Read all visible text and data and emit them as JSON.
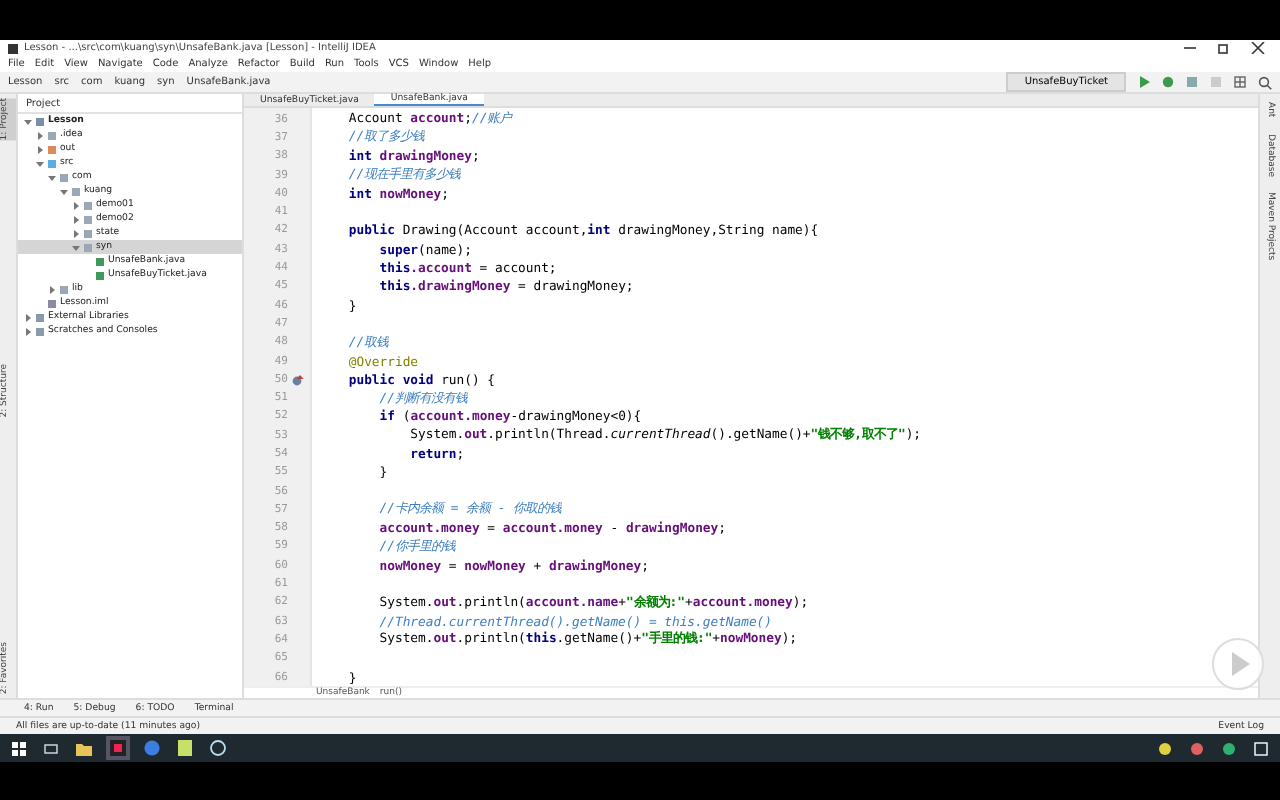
{
  "window": {
    "title": "Lesson - ...\\src\\com\\kuang\\syn\\UnsafeBank.java [Lesson] - IntelliJ IDEA"
  },
  "menu": [
    "File",
    "Edit",
    "View",
    "Navigate",
    "Code",
    "Analyze",
    "Refactor",
    "Build",
    "Run",
    "Tools",
    "VCS",
    "Window",
    "Help"
  ],
  "navbar": [
    "Lesson",
    "src",
    "com",
    "kuang",
    "syn",
    "UnsafeBank.java"
  ],
  "run_config": "UnsafeBuyTicket",
  "left_strip": [
    {
      "label": "1: Project",
      "selected": true
    },
    {
      "label": "2: Structure",
      "selected": false
    },
    {
      "label": "2: Favorites",
      "selected": false
    }
  ],
  "project": {
    "header": "Project",
    "tree": [
      {
        "label": "Lesson",
        "kind": "module",
        "expanded": true,
        "selected": false,
        "children": [
          {
            "label": ".idea",
            "kind": "folder",
            "expanded": false,
            "selected": false
          },
          {
            "label": "out",
            "kind": "excluded",
            "expanded": false,
            "selected": false
          },
          {
            "label": "src",
            "kind": "source",
            "expanded": true,
            "selected": false,
            "children": [
              {
                "label": "com",
                "kind": "folder",
                "expanded": true,
                "selected": false,
                "children": [
                  {
                    "label": "kuang",
                    "kind": "folder",
                    "expanded": true,
                    "selected": false,
                    "children": [
                      {
                        "label": "demo01",
                        "kind": "folder",
                        "expanded": false,
                        "selected": false
                      },
                      {
                        "label": "demo02",
                        "kind": "folder",
                        "expanded": false,
                        "selected": false
                      },
                      {
                        "label": "state",
                        "kind": "folder",
                        "expanded": false,
                        "selected": false
                      },
                      {
                        "label": "syn",
                        "kind": "folder",
                        "expanded": true,
                        "selected": true,
                        "children": [
                          {
                            "label": "UnsafeBank.java",
                            "kind": "java",
                            "selected": false
                          },
                          {
                            "label": "UnsafeBuyTicket.java",
                            "kind": "java",
                            "selected": false
                          }
                        ]
                      }
                    ]
                  }
                ]
              },
              {
                "label": "lib",
                "kind": "folder",
                "expanded": false,
                "selected": false
              }
            ]
          },
          {
            "label": "Lesson.iml",
            "kind": "file",
            "selected": false
          }
        ]
      },
      {
        "label": "External Libraries",
        "kind": "library",
        "expanded": false,
        "selected": false
      },
      {
        "label": "Scratches and Consoles",
        "kind": "library",
        "expanded": false,
        "selected": false
      }
    ]
  },
  "editor": {
    "tabs": [
      {
        "label": "UnsafeBuyTicket.java",
        "selected": false
      },
      {
        "label": "UnsafeBank.java",
        "selected": true
      }
    ],
    "lines": [
      {
        "number": "36",
        "gutter_marker": false,
        "tokens": [
          {
            "text": "    Account ",
            "kind": "plain"
          },
          {
            "text": "account",
            "kind": "field"
          },
          {
            "text": ";",
            "kind": "plain"
          },
          {
            "text": "//账户",
            "kind": "comment"
          }
        ]
      },
      {
        "number": "37",
        "gutter_marker": false,
        "tokens": [
          {
            "text": "    //取了多少钱",
            "kind": "comment"
          }
        ]
      },
      {
        "number": "38",
        "gutter_marker": false,
        "tokens": [
          {
            "text": "    int",
            "kind": "keyword"
          },
          {
            "text": " drawingMoney",
            "kind": "field"
          },
          {
            "text": ";",
            "kind": "plain"
          }
        ]
      },
      {
        "number": "39",
        "gutter_marker": false,
        "tokens": [
          {
            "text": "    //现在手里有多少钱",
            "kind": "comment"
          }
        ]
      },
      {
        "number": "40",
        "gutter_marker": false,
        "tokens": [
          {
            "text": "    int",
            "kind": "keyword"
          },
          {
            "text": " nowMoney",
            "kind": "field"
          },
          {
            "text": ";",
            "kind": "plain"
          }
        ]
      },
      {
        "number": "41",
        "gutter_marker": false
      },
      {
        "number": "42",
        "gutter_marker": false,
        "tokens": [
          {
            "text": "    public",
            "kind": "keyword"
          },
          {
            "text": " Drawing(Account account,",
            "kind": "plain"
          },
          {
            "text": "int",
            "kind": "keyword"
          },
          {
            "text": " drawingMoney,String name){",
            "kind": "plain"
          }
        ]
      },
      {
        "number": "43",
        "gutter_marker": false,
        "tokens": [
          {
            "text": "        super",
            "kind": "keyword"
          },
          {
            "text": "(name);",
            "kind": "plain"
          }
        ]
      },
      {
        "number": "44",
        "gutter_marker": false,
        "tokens": [
          {
            "text": "        this",
            "kind": "keyword"
          },
          {
            "text": ".account",
            "kind": "field"
          },
          {
            "text": " = account;",
            "kind": "plain"
          }
        ]
      },
      {
        "number": "45",
        "gutter_marker": false,
        "tokens": [
          {
            "text": "        this",
            "kind": "keyword"
          },
          {
            "text": ".drawingMoney",
            "kind": "field"
          },
          {
            "text": " = drawingMoney;",
            "kind": "plain"
          }
        ]
      },
      {
        "number": "46",
        "gutter_marker": false,
        "tokens": [
          {
            "text": "    }",
            "kind": "plain"
          }
        ]
      },
      {
        "number": "47",
        "gutter_marker": false
      },
      {
        "number": "48",
        "gutter_marker": false,
        "tokens": [
          {
            "text": "    //取钱",
            "kind": "comment"
          }
        ]
      },
      {
        "number": "49",
        "gutter_marker": false,
        "tokens": [
          {
            "text": "    @Override",
            "kind": "annotation"
          }
        ]
      },
      {
        "number": "50",
        "gutter_marker": true,
        "tokens": [
          {
            "text": "    public void",
            "kind": "keyword"
          },
          {
            "text": " run() {",
            "kind": "plain"
          }
        ]
      },
      {
        "number": "51",
        "gutter_marker": false,
        "tokens": [
          {
            "text": "        //判断有没有钱",
            "kind": "comment"
          }
        ]
      },
      {
        "number": "52",
        "gutter_marker": false,
        "tokens": [
          {
            "text": "        if",
            "kind": "keyword"
          },
          {
            "text": " (",
            "kind": "plain"
          },
          {
            "text": "account.money",
            "kind": "field"
          },
          {
            "text": "-drawingMoney<0){",
            "kind": "plain"
          }
        ]
      },
      {
        "number": "53",
        "gutter_marker": false,
        "tokens": [
          {
            "text": "            System.",
            "kind": "plain"
          },
          {
            "text": "out",
            "kind": "field"
          },
          {
            "text": ".println(Thread.",
            "kind": "plain"
          },
          {
            "text": "currentThread",
            "kind": "italic"
          },
          {
            "text": "().getName()+",
            "kind": "plain"
          },
          {
            "text": "\"钱不够,取不了\"",
            "kind": "string"
          },
          {
            "text": ");",
            "kind": "plain"
          }
        ]
      },
      {
        "number": "54",
        "gutter_marker": false,
        "tokens": [
          {
            "text": "            return",
            "kind": "keyword"
          },
          {
            "text": ";",
            "kind": "plain"
          }
        ]
      },
      {
        "number": "55",
        "gutter_marker": false,
        "tokens": [
          {
            "text": "        }",
            "kind": "plain"
          }
        ]
      },
      {
        "number": "56",
        "gutter_marker": false
      },
      {
        "number": "57",
        "gutter_marker": false,
        "tokens": [
          {
            "text": "        //卡内余额 = 余额 - 你取的钱",
            "kind": "comment"
          }
        ]
      },
      {
        "number": "58",
        "gutter_marker": false,
        "tokens": [
          {
            "text": "        account.money",
            "kind": "field"
          },
          {
            "text": " = ",
            "kind": "plain"
          },
          {
            "text": "account.money",
            "kind": "field"
          },
          {
            "text": " - ",
            "kind": "plain"
          },
          {
            "text": "drawingMoney",
            "kind": "field"
          },
          {
            "text": ";",
            "kind": "plain"
          }
        ]
      },
      {
        "number": "59",
        "gutter_marker": false,
        "tokens": [
          {
            "text": "        //你手里的钱",
            "kind": "comment"
          }
        ]
      },
      {
        "number": "60",
        "gutter_marker": false,
        "tokens": [
          {
            "text": "        nowMoney",
            "kind": "field"
          },
          {
            "text": " = ",
            "kind": "plain"
          },
          {
            "text": "nowMoney",
            "kind": "field"
          },
          {
            "text": " + ",
            "kind": "plain"
          },
          {
            "text": "drawingMoney",
            "kind": "field"
          },
          {
            "text": ";",
            "kind": "plain"
          }
        ]
      },
      {
        "number": "61",
        "gutter_marker": false
      },
      {
        "number": "62",
        "gutter_marker": false,
        "tokens": [
          {
            "text": "        System.",
            "kind": "plain"
          },
          {
            "text": "out",
            "kind": "field"
          },
          {
            "text": ".println(",
            "kind": "plain"
          },
          {
            "text": "account.name",
            "kind": "field"
          },
          {
            "text": "+",
            "kind": "plain"
          },
          {
            "text": "\"余额为:\"",
            "kind": "string"
          },
          {
            "text": "+",
            "kind": "plain"
          },
          {
            "text": "account.money",
            "kind": "field"
          },
          {
            "text": ");",
            "kind": "plain"
          }
        ]
      },
      {
        "number": "63",
        "gutter_marker": false,
        "tokens": [
          {
            "text": "        //Thread.currentThread().getName() = this.getName()",
            "kind": "comment"
          }
        ]
      },
      {
        "number": "64",
        "gutter_marker": false,
        "tokens": [
          {
            "text": "        System.",
            "kind": "plain"
          },
          {
            "text": "out",
            "kind": "field"
          },
          {
            "text": ".println(",
            "kind": "plain"
          },
          {
            "text": "this",
            "kind": "keyword"
          },
          {
            "text": ".getName()+",
            "kind": "plain"
          },
          {
            "text": "\"手里的钱:\"",
            "kind": "string"
          },
          {
            "text": "+",
            "kind": "plain"
          },
          {
            "text": "nowMoney",
            "kind": "field"
          },
          {
            "text": ");",
            "kind": "plain"
          }
        ]
      },
      {
        "number": "65",
        "gutter_marker": false
      },
      {
        "number": "66",
        "gutter_marker": false,
        "tokens": [
          {
            "text": "    }",
            "kind": "plain"
          }
        ]
      }
    ],
    "breadcrumb": [
      "UnsafeBank",
      "run()"
    ]
  },
  "right_strip": [
    "Ant",
    "Database",
    "Maven Projects"
  ],
  "bottom_tabs": [
    "4: Run",
    "5: Debug",
    "6: TODO",
    "Terminal"
  ],
  "status": {
    "message": "All files are up-to-date (11 minutes ago)",
    "event_log": "Event Log"
  }
}
